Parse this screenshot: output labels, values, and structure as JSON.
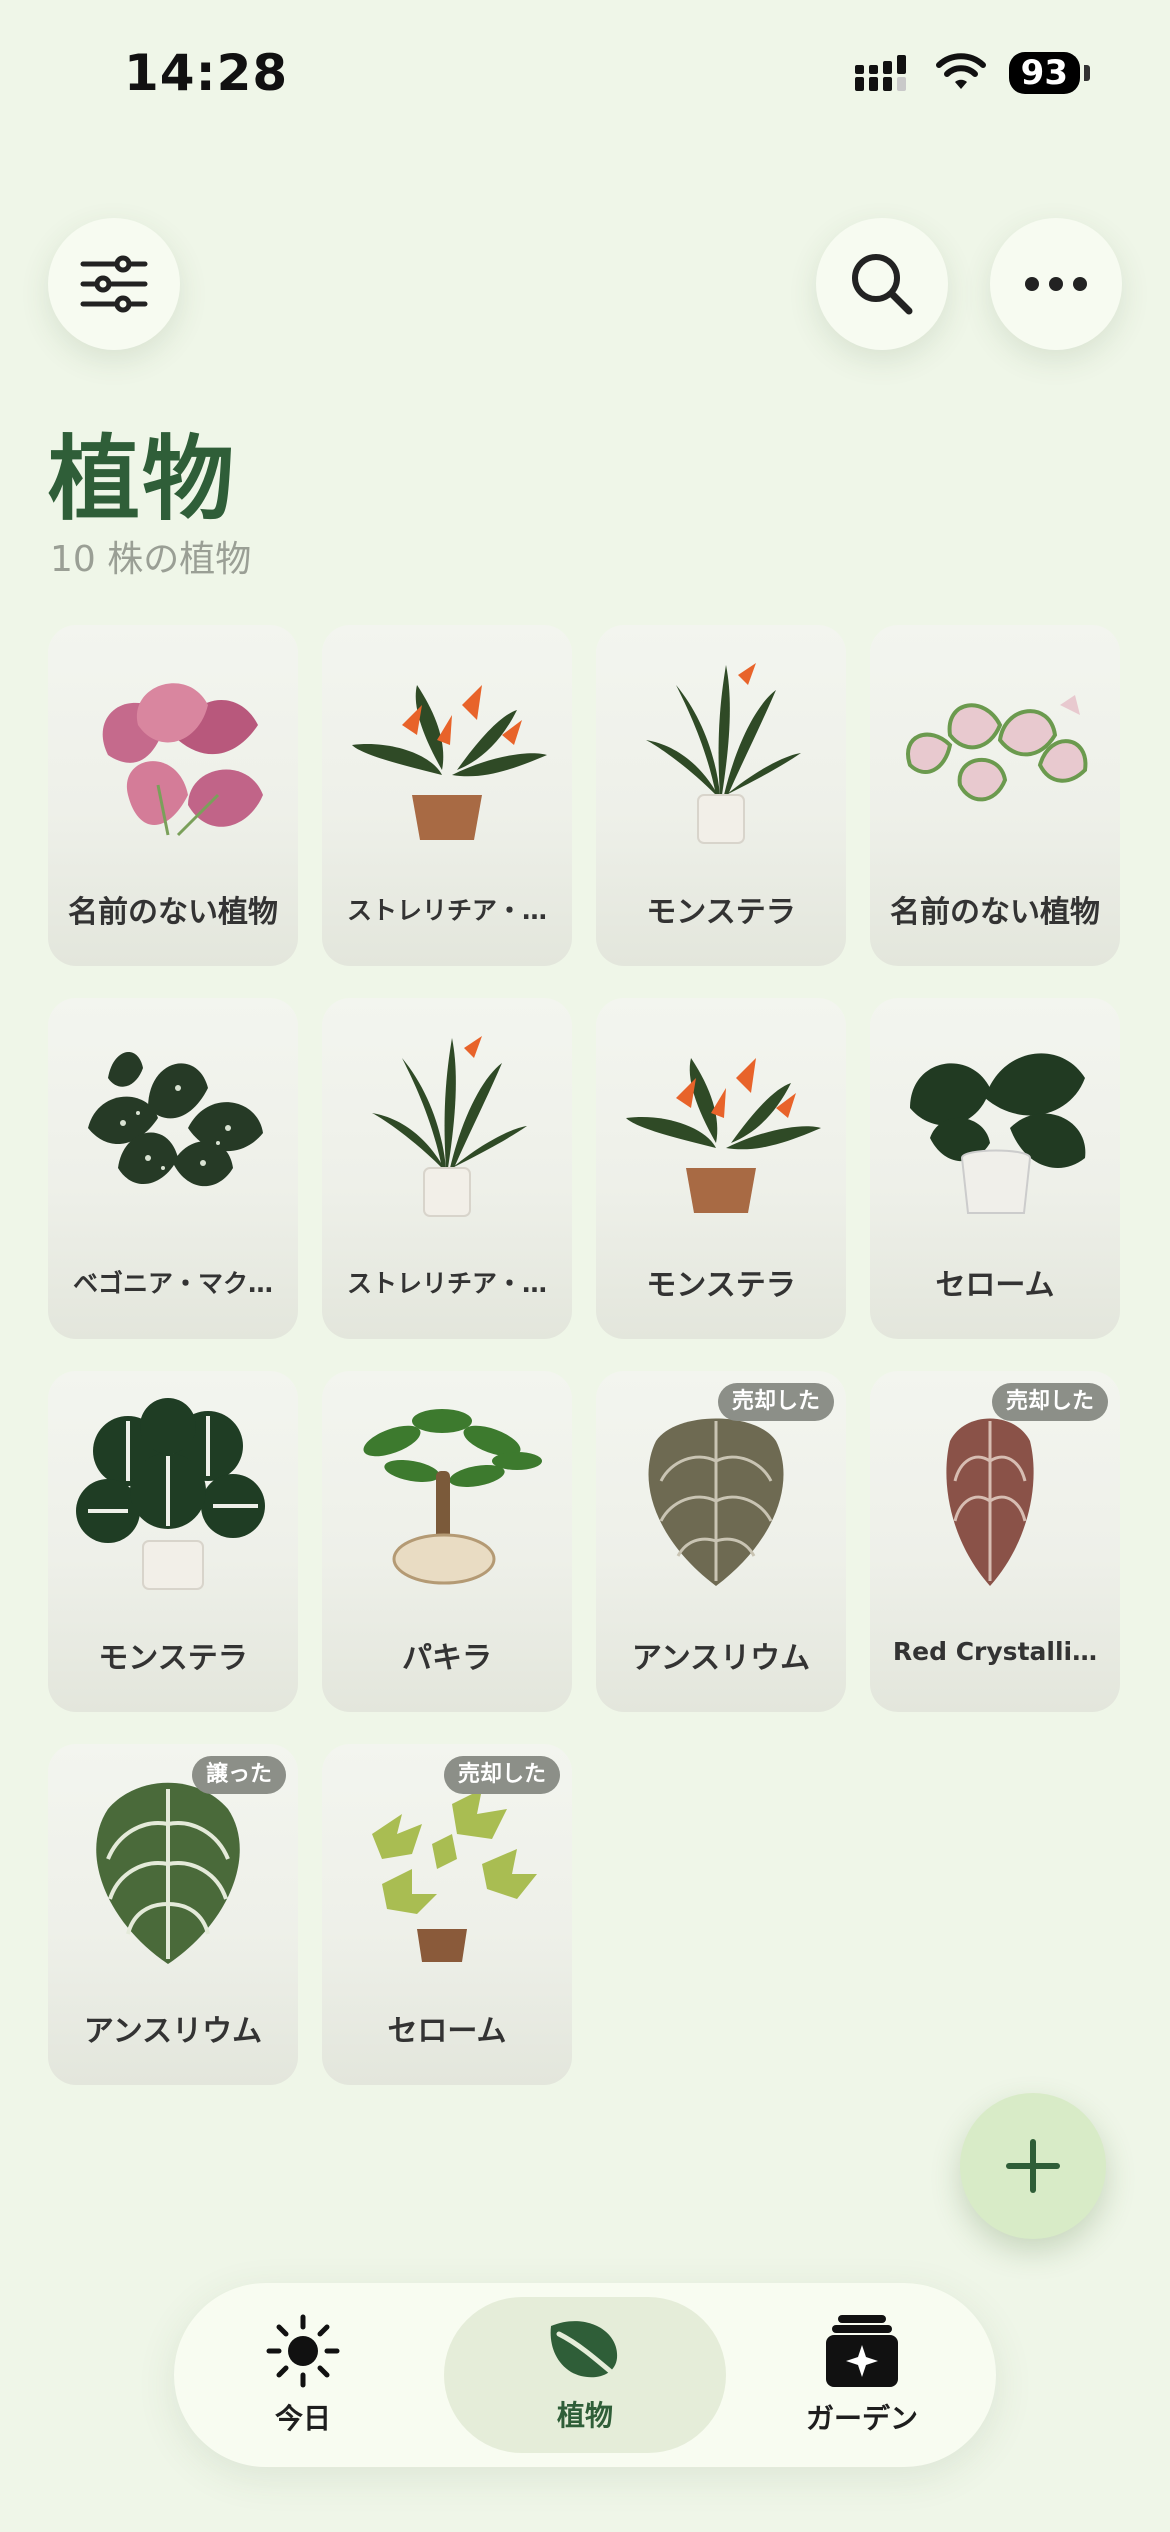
{
  "status_bar": {
    "time": "14:28",
    "battery": "93"
  },
  "header": {
    "title": "植物",
    "subtitle": "10 株の植物"
  },
  "plants": [
    {
      "name": "名前のない植物",
      "icon": "caladium-pink",
      "badge": ""
    },
    {
      "name": "ストレリチア・…",
      "icon": "bird-of-paradise-pot",
      "badge": ""
    },
    {
      "name": "モンステラ",
      "icon": "strelitzia-white-pot",
      "badge": ""
    },
    {
      "name": "名前のない植物",
      "icon": "caladium-white",
      "badge": ""
    },
    {
      "name": "ベゴニア・マク…",
      "icon": "begonia-maculata",
      "badge": ""
    },
    {
      "name": "ストレリチア・…",
      "icon": "strelitzia-white-pot",
      "badge": ""
    },
    {
      "name": "モンステラ",
      "icon": "bird-of-paradise-pot",
      "badge": ""
    },
    {
      "name": "セローム",
      "icon": "philodendron-selloum",
      "badge": ""
    },
    {
      "name": "モンステラ",
      "icon": "monstera",
      "badge": ""
    },
    {
      "name": "パキラ",
      "icon": "pachira",
      "badge": ""
    },
    {
      "name": "アンスリウム",
      "icon": "anthurium-crystallinum",
      "badge": "売却した"
    },
    {
      "name": "Red Crystalli…",
      "icon": "red-crystallinum",
      "badge": "売却した"
    },
    {
      "name": "アンスリウム",
      "icon": "anthurium-veitchii",
      "badge": "譲った"
    },
    {
      "name": "セローム",
      "icon": "selloum-yellow",
      "badge": "売却した"
    }
  ],
  "tabs": [
    {
      "label": "今日",
      "icon": "sun-icon",
      "active": false
    },
    {
      "label": "植物",
      "icon": "leaf-icon",
      "active": true
    },
    {
      "label": "ガーデン",
      "icon": "garden-sparkle-icon",
      "active": false
    }
  ],
  "colors": {
    "accent": "#2f5e38",
    "background": "#eff6e8",
    "fab": "#d8ebc7",
    "badge": "#8c8f88"
  }
}
